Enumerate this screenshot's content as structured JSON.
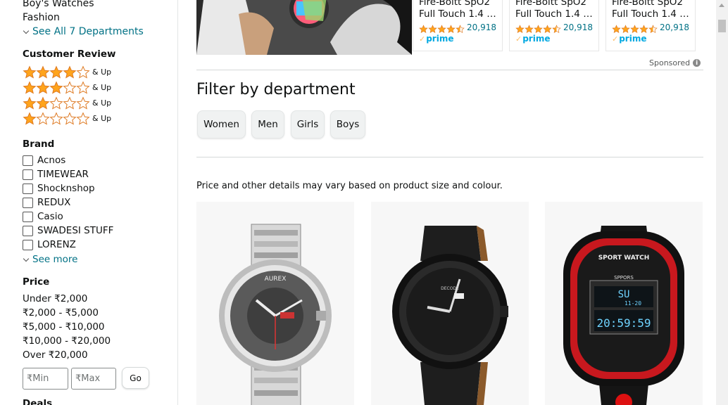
{
  "sidebar": {
    "departments": [
      "Boy's Watches",
      "Fashion"
    ],
    "see_all": "See All 7 Departments",
    "review_title": "Customer Review",
    "reviews": [
      {
        "stars": 4,
        "label": "& Up"
      },
      {
        "stars": 3,
        "label": "& Up"
      },
      {
        "stars": 2,
        "label": "& Up"
      },
      {
        "stars": 1,
        "label": "& Up"
      }
    ],
    "brand_title": "Brand",
    "brands": [
      "Acnos",
      "TIMEWEAR",
      "Shocknshop",
      "REDUX",
      "Casio",
      "SWADESI STUFF",
      "LORENZ"
    ],
    "see_more": "See more",
    "price_title": "Price",
    "prices": [
      "Under ₹2,000",
      "₹2,000 - ₹5,000",
      "₹5,000 - ₹10,000",
      "₹10,000 - ₹20,000",
      "Over ₹20,000"
    ],
    "min_placeholder": "₹Min",
    "max_placeholder": "₹Max",
    "go_label": "Go",
    "deals_title": "Deals"
  },
  "ads": [
    {
      "title": "Fire-Boltt SpO2 Full Touch 1.4 i...",
      "line1": "Fire-Boltt SpO2",
      "line2": "Full Touch 1.4 i...",
      "rating": 4.5,
      "count": "20,918",
      "prime": "prime"
    },
    {
      "title": "Fire-Boltt SpO2 Full Touch 1.4 i...",
      "line1": "Fire-Boltt SpO2",
      "line2": "Full Touch 1.4 i...",
      "rating": 4.5,
      "count": "20,918",
      "prime": "prime"
    },
    {
      "title": "Fire-Boltt SpO2 Full Touch 1.4 i...",
      "line1": "Fire-Boltt SpO2",
      "line2": "Full Touch 1.4 i...",
      "rating": 4.5,
      "count": "20,918",
      "prime": "prime"
    }
  ],
  "sponsored": "Sponsored",
  "filter_title": "Filter by department",
  "dept_buttons": [
    "Women",
    "Men",
    "Girls",
    "Boys"
  ],
  "note": "Price and other details may vary based on product size and colour.",
  "products": [
    {
      "name": "watch-product-1",
      "brand_text": "AUREX",
      "style": "silver-analog"
    },
    {
      "name": "watch-product-2",
      "brand_text": "DECODE",
      "style": "black-leather-analog"
    },
    {
      "name": "watch-product-3",
      "brand_text": "SPORT WATCH",
      "style": "digital-sport",
      "digits_top": "SU",
      "digits_mid": "11-20",
      "digits_main": "20:59:59",
      "sub": "SPPORS"
    }
  ],
  "colors": {
    "link": "#007185",
    "star": "#ffa41c",
    "prime": "#00a8e1"
  }
}
